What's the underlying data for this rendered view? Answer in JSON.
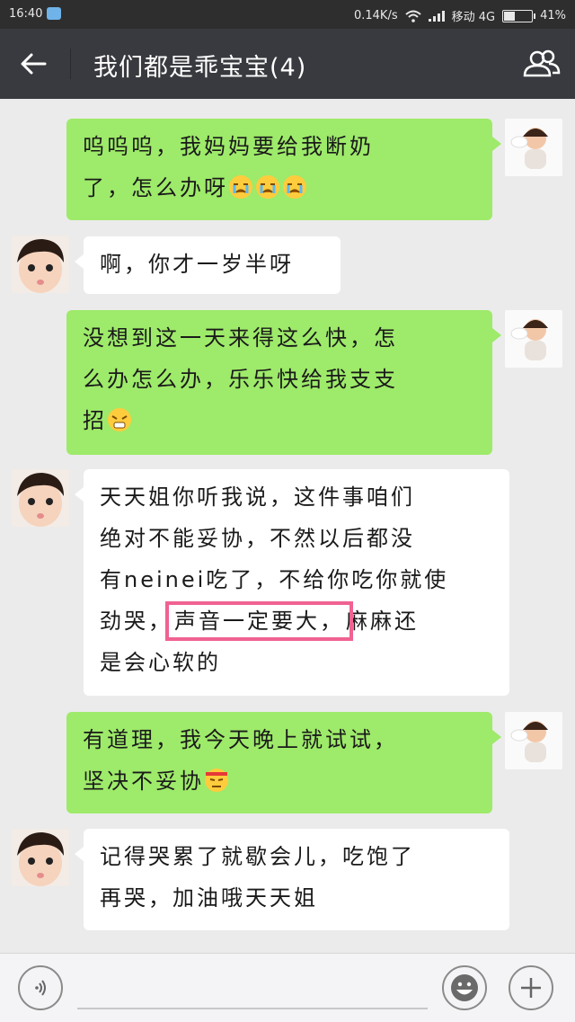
{
  "status_bar": {
    "time": "16:40",
    "network_speed": "0.14K/s",
    "carrier": "移动 4G",
    "battery_percent": "41%",
    "battery_level": 0.41
  },
  "header": {
    "title": "我们都是乖宝宝(4)",
    "back_icon": "arrow-left-icon",
    "members_icon": "group-members-icon"
  },
  "messages": [
    {
      "side": "sent",
      "lines": [
        "呜呜呜，我妈妈要给我断奶",
        "了，怎么办呀"
      ],
      "emoji": "crying-emoji x3"
    },
    {
      "side": "received",
      "lines": [
        "啊，你才一岁半呀"
      ]
    },
    {
      "side": "sent",
      "lines": [
        "没想到这一天来得这么快，怎",
        "么办怎么办，乐乐快给我支支",
        "招"
      ],
      "emoji": "sad-emoji"
    },
    {
      "side": "received",
      "lines": [
        "天天姐你听我说，这件事咱们",
        "绝对不能妥协，不然以后都没",
        "有neinei吃了，不给你吃你就使",
        "劲哭，",
        "声音一定要大，",
        "麻麻还",
        "是会心软的"
      ]
    },
    {
      "side": "sent",
      "lines": [
        "有道理，我今天晚上就试试，",
        "坚决不妥协"
      ],
      "emoji": "determined-emoji"
    },
    {
      "side": "received",
      "lines": [
        "记得哭累了就歇会儿，吃饱了",
        "再哭，加油哦天天姐"
      ]
    }
  ],
  "colors": {
    "sent_bubble": "#9eea6a",
    "received_bubble": "#ffffff",
    "highlight": "#f06292",
    "header_bg": "#393a3f"
  },
  "bottom_bar": {
    "voice_icon": "voice-icon",
    "emoji_icon": "smiley-icon",
    "plus_icon": "plus-icon"
  }
}
